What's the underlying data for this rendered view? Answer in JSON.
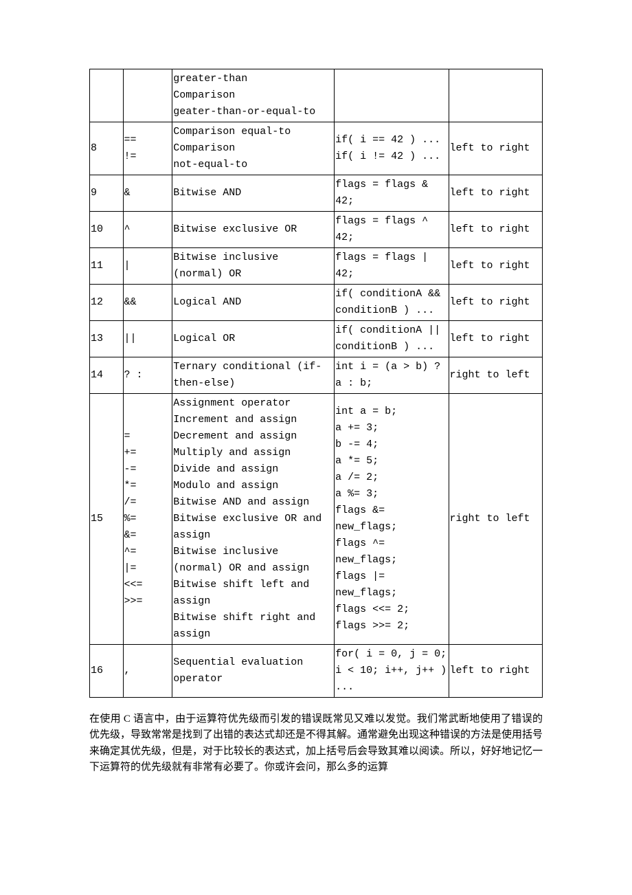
{
  "table": {
    "rows": [
      {
        "level": "",
        "op": "",
        "desc": "greater-than\nComparison\ngeater-than-or-equal-to",
        "example": "",
        "assoc": ""
      },
      {
        "level": "8",
        "op": "==\n!=",
        "desc": "Comparison equal-to\nComparison\nnot-equal-to",
        "example": "if( i == 42 ) ...\nif( i != 42 ) ...",
        "assoc": "left to right"
      },
      {
        "level": "9",
        "op": "&",
        "desc": "Bitwise AND",
        "example": "flags = flags & 42;",
        "assoc": "left to right"
      },
      {
        "level": "10",
        "op": "^",
        "desc": "Bitwise exclusive OR",
        "example": "flags = flags ^ 42;",
        "assoc": "left to right"
      },
      {
        "level": "11",
        "op": "|",
        "desc": "Bitwise inclusive (normal) OR",
        "example": "flags = flags | 42;",
        "assoc": "left to right"
      },
      {
        "level": "12",
        "op": "&&",
        "desc": "Logical AND",
        "example": "if( conditionA && conditionB ) ...",
        "assoc": "left to right"
      },
      {
        "level": "13",
        "op": "||",
        "desc": "Logical OR",
        "example": "if( conditionA || conditionB ) ...",
        "assoc": "left to right"
      },
      {
        "level": "14",
        "op": "? :",
        "desc": "Ternary conditional (if-then-else)",
        "example": "int i = (a > b) ? a : b;",
        "assoc": "right to left"
      },
      {
        "level": "15",
        "op": "=\n+=\n-=\n*=\n/=\n%=\n&=\n^=\n|=\n<<=\n>>=",
        "desc": "Assignment operator\nIncrement and assign\nDecrement and assign\nMultiply and assign\nDivide and assign\nModulo and assign\nBitwise AND and assign\nBitwise exclusive OR and assign\nBitwise inclusive (normal) OR and assign\nBitwise shift left and assign\nBitwise shift right and assign",
        "example": "int a = b;\na += 3;\nb -= 4;\na *= 5;\na /= 2;\na %= 3;\nflags &= new_flags;\nflags ^= new_flags;\nflags |= new_flags;\nflags <<= 2;\nflags >>= 2;",
        "assoc": "right to left"
      },
      {
        "level": "16",
        "op": ",",
        "desc": "Sequential evaluation operator",
        "example": "for( i = 0, j = 0; i < 10; i++, j++ ) ...",
        "assoc": "left to right"
      }
    ]
  },
  "paragraph": "在使用 C 语言中，由于运算符优先级而引发的错误既常见又难以发觉。我们常武断地使用了错误的优先级，导致常常是找到了出错的表达式却还是不得其解。通常避免出现这种错误的方法是使用括号来确定其优先级，但是，对于比较长的表达式，加上括号后会导致其难以阅读。所以，好好地记忆一下运算符的优先级就有非常有必要了。你或许会问，那么多的运算"
}
